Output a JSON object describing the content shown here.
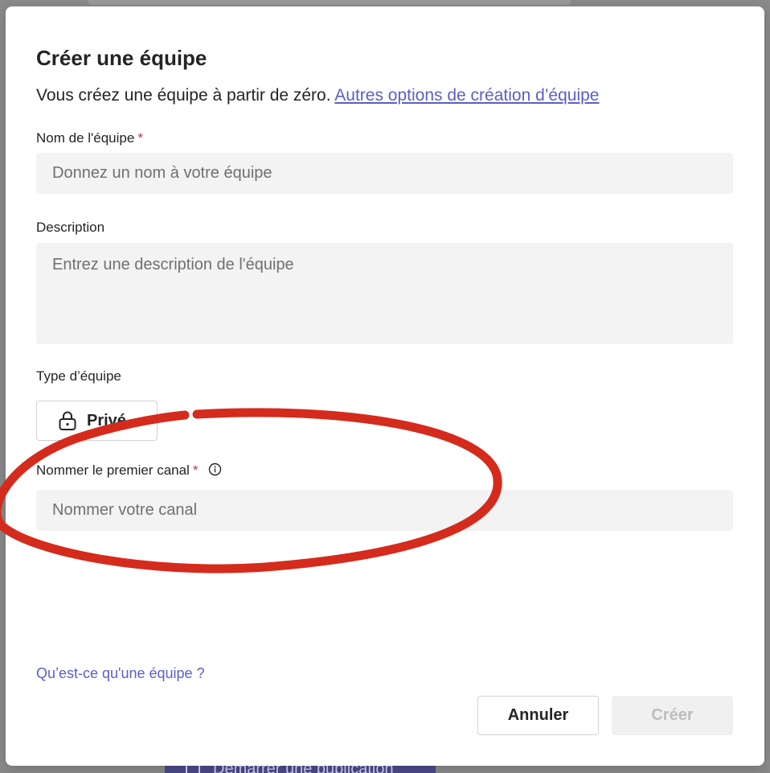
{
  "background": {
    "button_label": "Démarrer une publication"
  },
  "dialog": {
    "title": "Créer une équipe",
    "subtitle": "Vous créez une équipe à partir de zéro.",
    "options_link": "Autres options de création d’équipe"
  },
  "team_name": {
    "label": "Nom de l'équipe",
    "required_mark": "*",
    "placeholder": "Donnez un nom à votre équipe",
    "value": ""
  },
  "description": {
    "label": "Description",
    "placeholder": "Entrez une description de l'équipe",
    "value": ""
  },
  "team_type": {
    "label": "Type d’équipe",
    "selected": "Privé",
    "icon": "lock-icon"
  },
  "first_channel": {
    "label": "Nommer le premier canal",
    "required_mark": "*",
    "info_icon": "info-icon",
    "placeholder": "Nommer votre canal",
    "value": ""
  },
  "help_link": "Qu’est-ce qu'une équipe ?",
  "actions": {
    "cancel": "Annuler",
    "create": "Créer"
  },
  "colors": {
    "accent": "#5b5fc7",
    "required": "#c4314b",
    "annotation": "#d42b1c",
    "field_bg": "#f3f3f3"
  }
}
